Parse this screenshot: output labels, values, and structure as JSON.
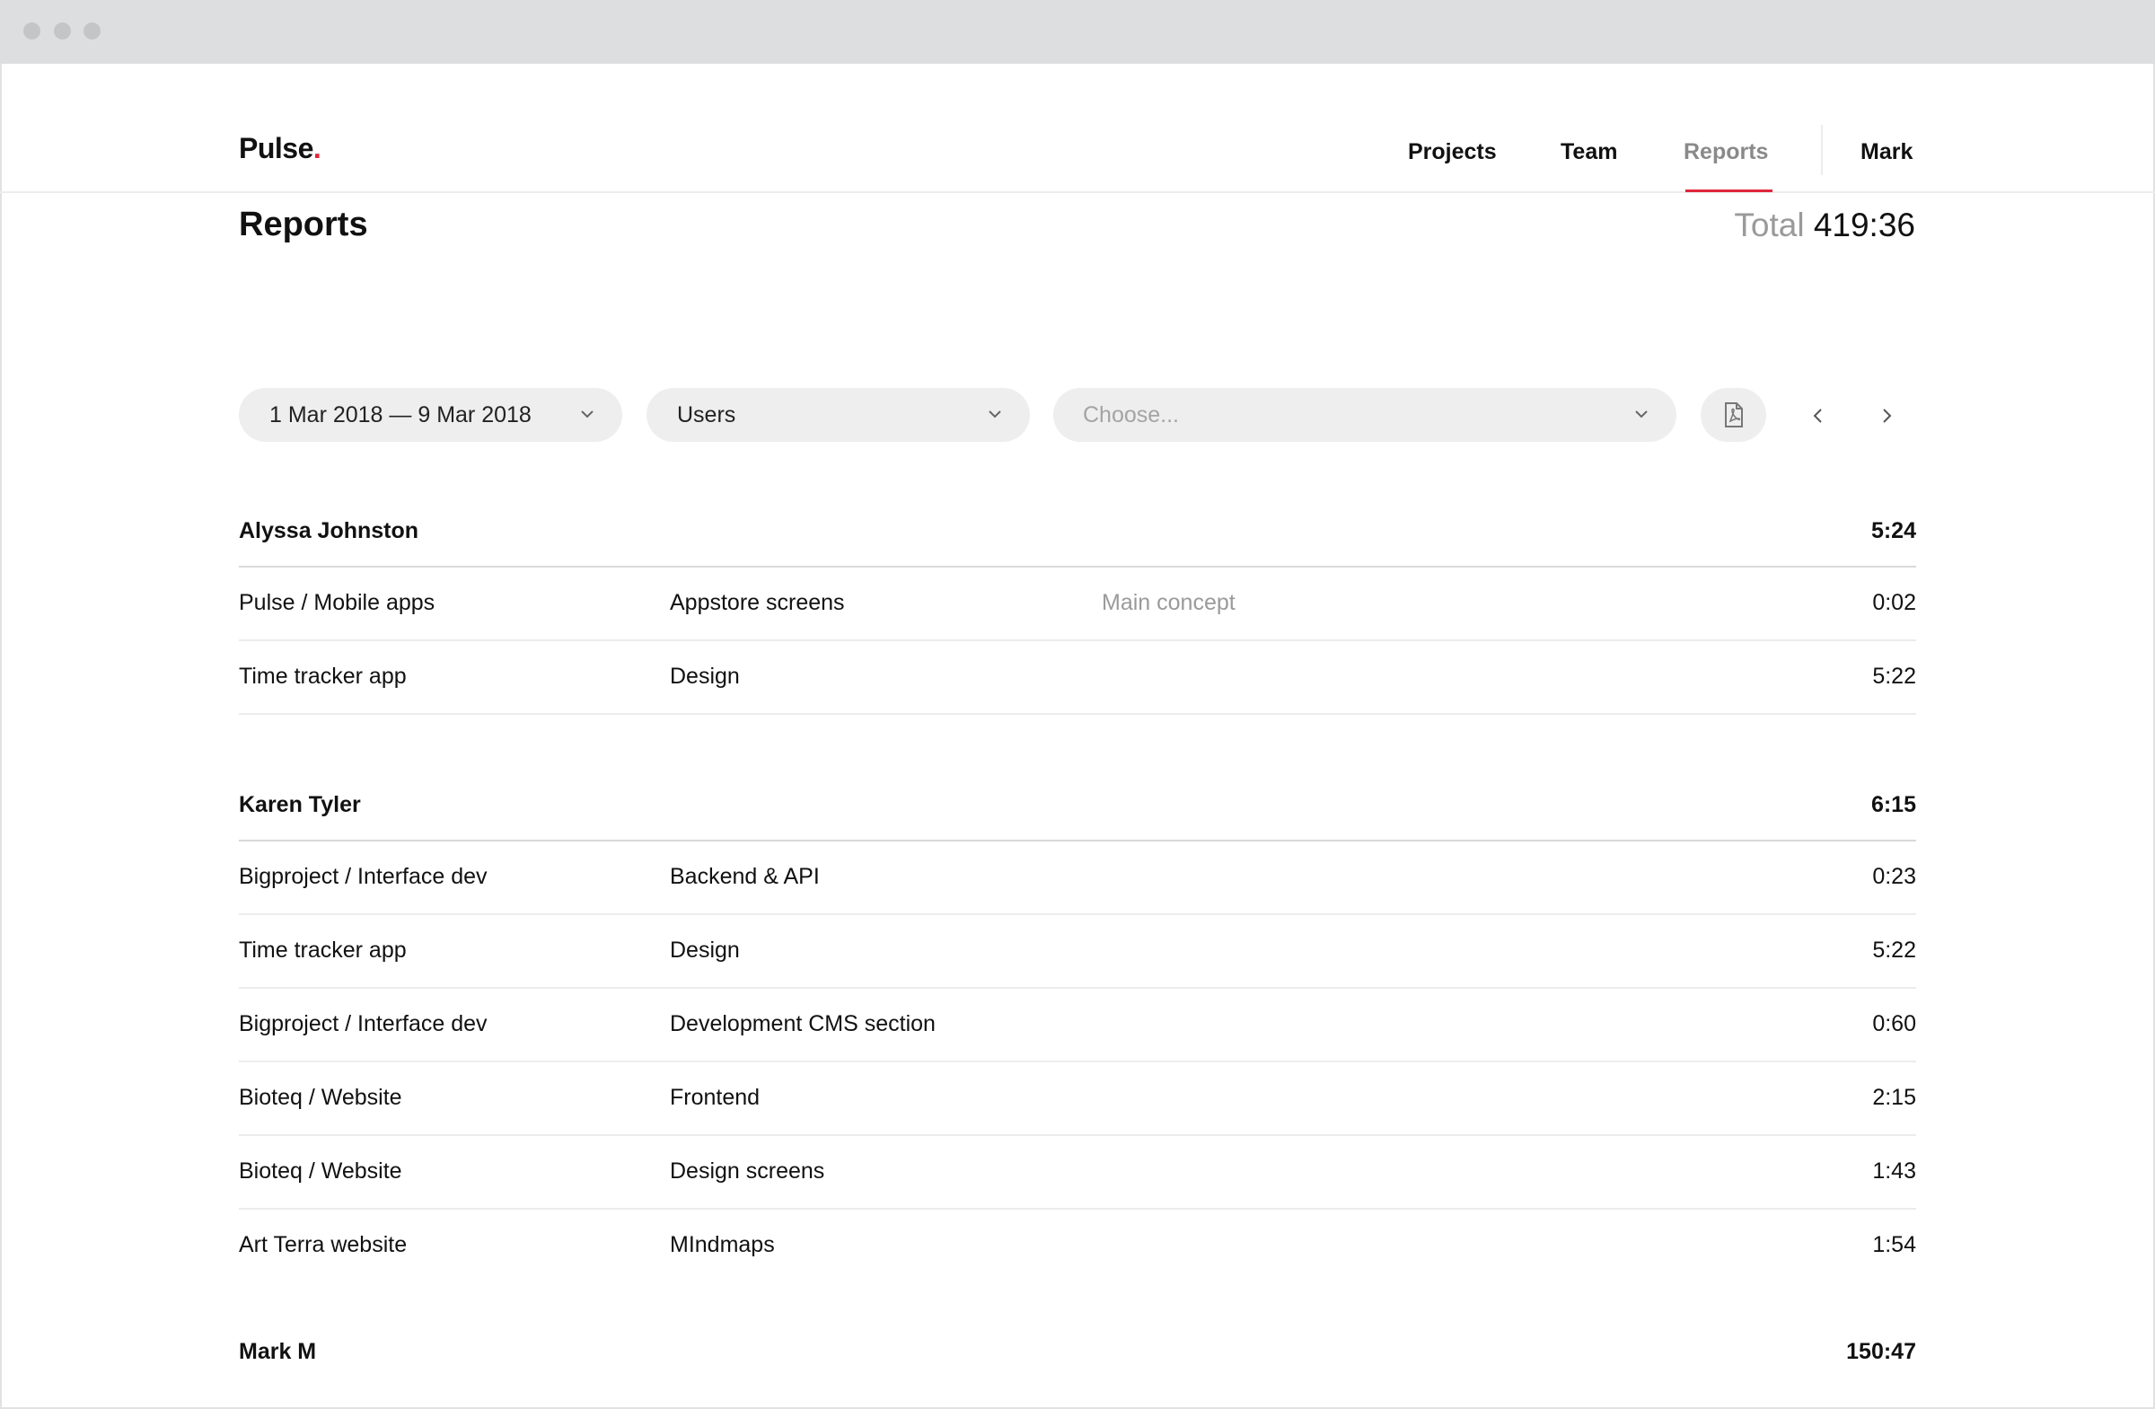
{
  "app": {
    "logo": "Pulse",
    "logo_dot": "."
  },
  "nav": {
    "items": [
      {
        "label": "Projects",
        "active": false
      },
      {
        "label": "Team",
        "active": false
      },
      {
        "label": "Reports",
        "active": true
      }
    ],
    "user": "Mark"
  },
  "page": {
    "title": "Reports",
    "total_label": "Total",
    "total_value": "419:36"
  },
  "filters": {
    "date_range": "1 Mar 2018 — 9 Mar 2018",
    "group_by": "Users",
    "choose_placeholder": "Choose..."
  },
  "icons": {
    "export": "pdf-file-icon",
    "prev": "chevron-left-icon",
    "next": "chevron-right-icon",
    "dropdown": "chevron-down-icon"
  },
  "colors": {
    "accent": "#e0273c",
    "pill_bg": "#eeeeee",
    "muted": "#9a9a9a"
  },
  "groups": [
    {
      "name": "Alyssa Johnston",
      "total": "5:24",
      "rows": [
        {
          "project": "Pulse / Mobile apps",
          "task": "Appstore screens",
          "note": "Main concept",
          "time": "0:02"
        },
        {
          "project": "Time tracker app",
          "task": "Design",
          "note": "",
          "time": "5:22"
        }
      ]
    },
    {
      "name": "Karen Tyler",
      "total": "6:15",
      "rows": [
        {
          "project": "Bigproject / Interface dev",
          "task": "Backend & API",
          "note": "",
          "time": "0:23"
        },
        {
          "project": "Time tracker app",
          "task": "Design",
          "note": "",
          "time": "5:22"
        },
        {
          "project": "Bigproject / Interface dev",
          "task": "Development CMS section",
          "note": "",
          "time": "0:60"
        },
        {
          "project": "Bioteq / Website",
          "task": "Frontend",
          "note": "",
          "time": "2:15"
        },
        {
          "project": "Bioteq / Website",
          "task": "Design screens",
          "note": "",
          "time": "1:43"
        },
        {
          "project": "Art Terra website",
          "task": "MIndmaps",
          "note": "",
          "time": "1:54"
        }
      ]
    },
    {
      "name": "Mark M",
      "total": "150:47",
      "rows": []
    }
  ]
}
